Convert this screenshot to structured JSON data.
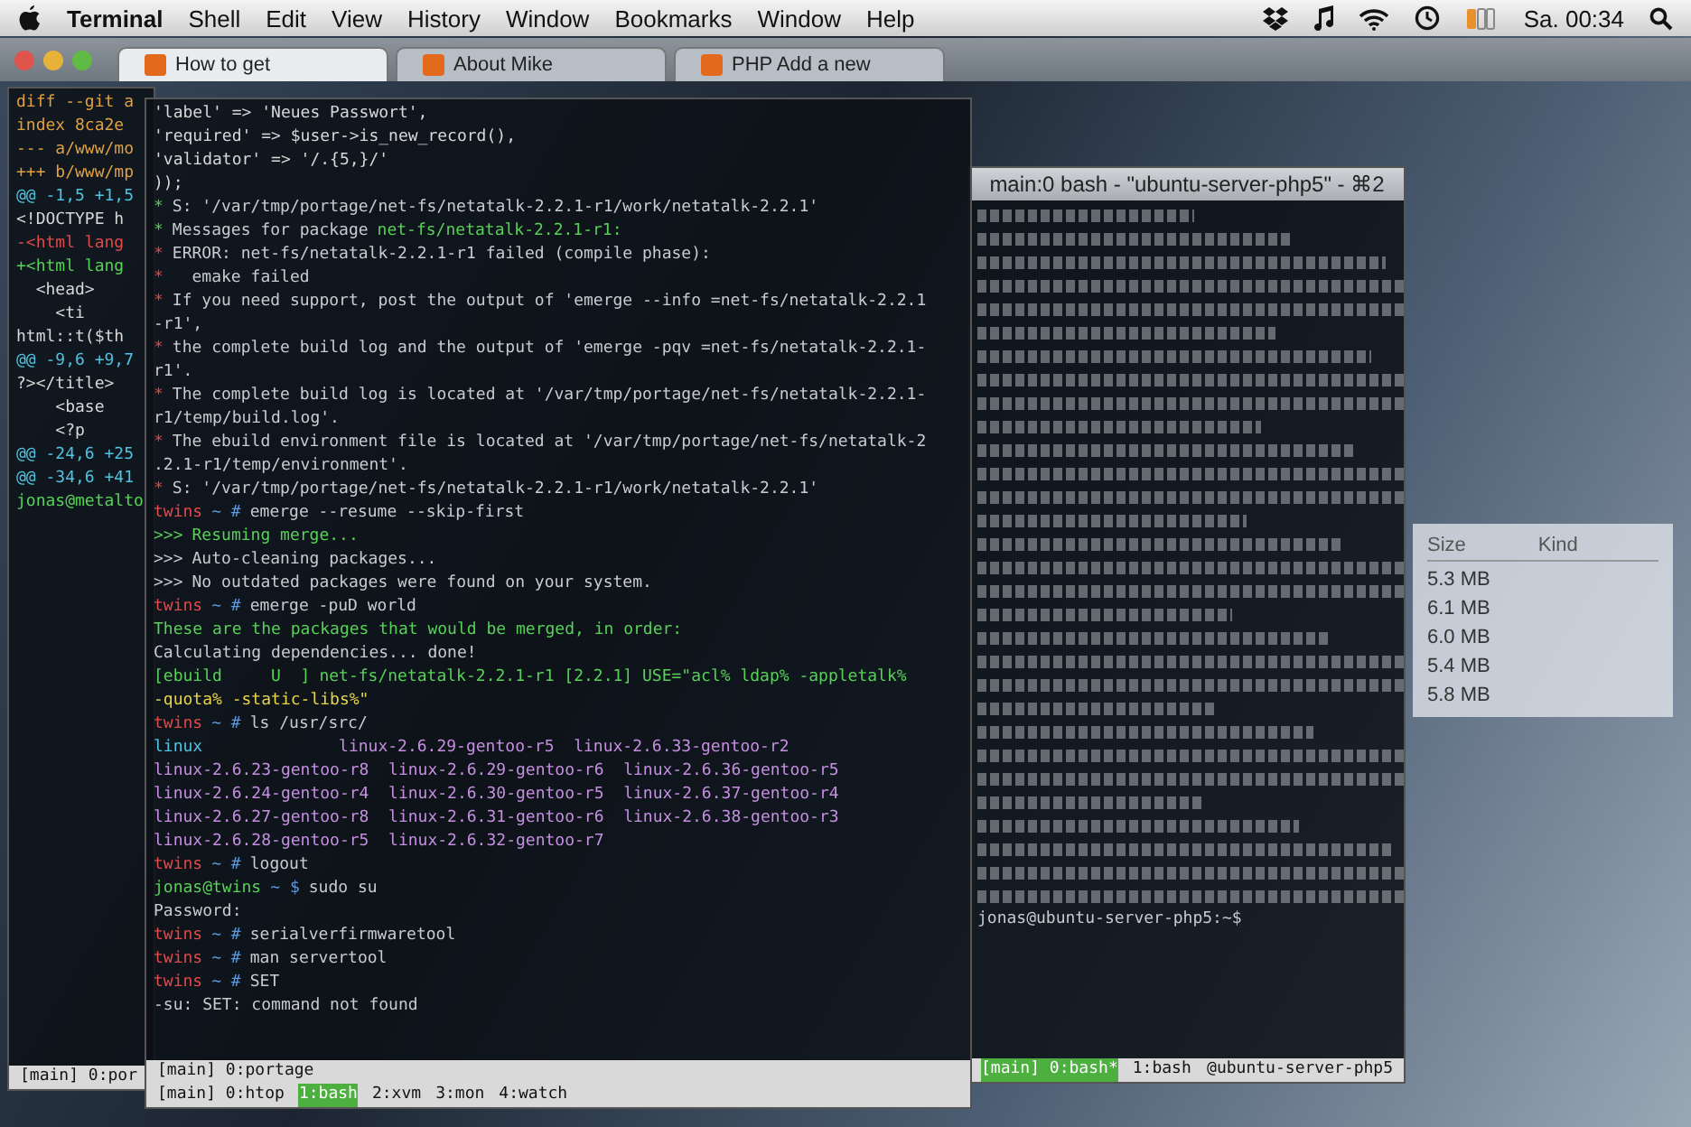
{
  "menubar": {
    "app": "Terminal",
    "menus": [
      "Shell",
      "Edit",
      "View",
      "History",
      "Window",
      "Bookmarks",
      "Window",
      "Help"
    ],
    "clock": "Sa. 00:34"
  },
  "browser": {
    "tabs": [
      {
        "label": "How to get",
        "selected": true
      },
      {
        "label": "About Mike",
        "selected": false
      },
      {
        "label": "PHP Add a new",
        "selected": false
      }
    ]
  },
  "left_terminal": {
    "lines": [
      {
        "text": "diff --git a",
        "kind": "header"
      },
      {
        "text": "index 8ca2e",
        "kind": "header"
      },
      {
        "text": "--- a/www/mo",
        "kind": "header"
      },
      {
        "text": "+++ b/www/mp",
        "kind": "header"
      },
      {
        "text": "@@ -1,5 +1,5",
        "kind": "hunk"
      },
      {
        "text": "<!DOCTYPE h",
        "kind": "code"
      },
      {
        "text": "-<html lang",
        "kind": "removed"
      },
      {
        "text": "+<html lang",
        "kind": "added"
      },
      {
        "text": "  <head>",
        "kind": "code"
      },
      {
        "text": "    <ti",
        "kind": "code"
      },
      {
        "text": "html::t($th",
        "kind": "code"
      },
      {
        "text": "@@ -9,6 +9,7",
        "kind": "hunk"
      },
      {
        "text": "?></title>",
        "kind": "code"
      },
      {
        "text": "    <base",
        "kind": "code"
      },
      {
        "text": "    <?p",
        "kind": "code"
      },
      {
        "text": "@@ -24,6 +25",
        "kind": "hunk"
      },
      {
        "text": "@@ -34,6 +41",
        "kind": "hunk"
      },
      {
        "text": "jonas@metalto",
        "kind": "prompt"
      }
    ],
    "status": "[main] 0:por"
  },
  "middle_terminal": {
    "lines": [
      {
        "parts": [
          {
            "text": "'label' => 'Neues Passwort',",
            "kind": "code"
          }
        ]
      },
      {
        "parts": [
          {
            "text": "'required' => $user->is_new_record(),",
            "kind": "code"
          }
        ]
      },
      {
        "parts": [
          {
            "text": "'validator' => '/.{5,}/'",
            "kind": "code"
          }
        ]
      },
      {
        "parts": [
          {
            "text": "));",
            "kind": "code"
          }
        ]
      },
      {
        "parts": [
          {
            "text": "*",
            "kind": "star"
          },
          {
            "text": "S: '/var/tmp/portage/net-fs/netatalk-2.2.1-r1/work/netatalk-2.2.1'",
            "kind": "plain"
          }
        ]
      },
      {
        "parts": [
          {
            "text": "*",
            "kind": "star"
          },
          {
            "text": "Messages for package",
            "kind": "plain"
          },
          {
            "text": "net-fs/netatalk-2.2.1-r1:",
            "kind": "ok"
          }
        ]
      },
      {
        "parts": [
          {
            "text": "*",
            "kind": "error"
          },
          {
            "text": "ERROR: net-fs/netatalk-2.2.1-r1 failed (compile phase):",
            "kind": "plain"
          }
        ]
      },
      {
        "parts": [
          {
            "text": "*",
            "kind": "error"
          },
          {
            "text": "  emake failed",
            "kind": "plain"
          }
        ]
      },
      {
        "parts": [
          {
            "text": "*",
            "kind": "error"
          },
          {
            "text": "If you need support, post the output of 'emerge --info =net-fs/netatalk-2.2.1",
            "kind": "plain"
          }
        ]
      },
      {
        "parts": [
          {
            "text": "-r1',",
            "kind": "plain"
          }
        ]
      },
      {
        "parts": [
          {
            "text": "*",
            "kind": "error"
          },
          {
            "text": "the complete build log and the output of 'emerge -pqv =net-fs/netatalk-2.2.1-",
            "kind": "plain"
          }
        ]
      },
      {
        "parts": [
          {
            "text": "r1'.",
            "kind": "plain"
          }
        ]
      },
      {
        "parts": [
          {
            "text": "*",
            "kind": "error"
          },
          {
            "text": "The complete build log is located at '/var/tmp/portage/net-fs/netatalk-2.2.1-",
            "kind": "plain"
          }
        ]
      },
      {
        "parts": [
          {
            "text": "r1/temp/build.log'.",
            "kind": "plain"
          }
        ]
      },
      {
        "parts": [
          {
            "text": "*",
            "kind": "error"
          },
          {
            "text": "The ebuild environment file is located at '/var/tmp/portage/net-fs/netatalk-2",
            "kind": "plain"
          }
        ]
      },
      {
        "parts": [
          {
            "text": ".2.1-r1/temp/environment'.",
            "kind": "plain"
          }
        ]
      },
      {
        "parts": [
          {
            "text": "*",
            "kind": "error"
          },
          {
            "text": "S: '/var/tmp/portage/net-fs/netatalk-2.2.1-r1/work/netatalk-2.2.1'",
            "kind": "plain"
          }
        ]
      },
      {
        "parts": [
          {
            "text": "twins",
            "kind": "host"
          },
          {
            "text": "~ #",
            "kind": "path"
          },
          {
            "text": "emerge --resume --skip-first",
            "kind": "plain"
          }
        ]
      },
      {
        "parts": [
          {
            "text": ">>>",
            "kind": "ok"
          },
          {
            "text": "Resuming merge...",
            "kind": "ok"
          }
        ]
      },
      {
        "parts": [
          {
            "text": ">>>",
            "kind": "plain"
          },
          {
            "text": "Auto-cleaning packages...",
            "kind": "plain"
          }
        ]
      },
      {
        "parts": [
          {
            "text": ">>>",
            "kind": "plain"
          },
          {
            "text": "No outdated packages were found on your system.",
            "kind": "plain"
          }
        ]
      },
      {
        "parts": [
          {
            "text": "twins",
            "kind": "host"
          },
          {
            "text": "~ #",
            "kind": "path"
          },
          {
            "text": "emerge -puD world",
            "kind": "plain"
          }
        ]
      },
      {
        "parts": [
          {
            "text": "These are the packages that would be merged, in order:",
            "kind": "ok"
          }
        ]
      },
      {
        "parts": [
          {
            "text": "Calculating dependencies... done!",
            "kind": "plain"
          }
        ]
      },
      {
        "parts": [
          {
            "text": "[ebuild     U  ]",
            "kind": "ok"
          },
          {
            "text": "net-fs/netatalk-2.2.1-r1 [2.2.1] USE=\"acl% ldap% -appletalk%",
            "kind": "ok"
          }
        ]
      },
      {
        "parts": [
          {
            "text": "-quota% -static-libs%\"",
            "kind": "warn"
          }
        ]
      },
      {
        "parts": [
          {
            "text": "twins",
            "kind": "host"
          },
          {
            "text": "~ #",
            "kind": "path"
          },
          {
            "text": "ls /usr/src/",
            "kind": "plain"
          }
        ]
      },
      {
        "parts": [
          {
            "text": "linux",
            "kind": "dir"
          },
          {
            "text": "             linux-2.6.29-gentoo-r5  linux-2.6.33-gentoo-r2",
            "kind": "link"
          }
        ]
      },
      {
        "parts": [
          {
            "text": "linux-2.6.23-gentoo-r8  linux-2.6.29-gentoo-r6  linux-2.6.36-gentoo-r5",
            "kind": "link"
          }
        ]
      },
      {
        "parts": [
          {
            "text": "linux-2.6.24-gentoo-r4  linux-2.6.30-gentoo-r5  linux-2.6.37-gentoo-r4",
            "kind": "link"
          }
        ]
      },
      {
        "parts": [
          {
            "text": "linux-2.6.27-gentoo-r8  linux-2.6.31-gentoo-r6  linux-2.6.38-gentoo-r3",
            "kind": "link"
          }
        ]
      },
      {
        "parts": [
          {
            "text": "linux-2.6.28-gentoo-r5  linux-2.6.32-gentoo-r7",
            "kind": "link"
          }
        ]
      },
      {
        "parts": [
          {
            "text": "twins",
            "kind": "host"
          },
          {
            "text": "~ #",
            "kind": "path"
          },
          {
            "text": "logout",
            "kind": "plain"
          }
        ]
      },
      {
        "parts": [
          {
            "text": "jonas@twins",
            "kind": "ok"
          },
          {
            "text": "~ $",
            "kind": "path"
          },
          {
            "text": "sudo su",
            "kind": "plain"
          }
        ]
      },
      {
        "parts": [
          {
            "text": "Password:",
            "kind": "plain"
          }
        ]
      },
      {
        "parts": [
          {
            "text": "twins",
            "kind": "host"
          },
          {
            "text": "~ #",
            "kind": "path"
          },
          {
            "text": "serialverfirmwaretool",
            "kind": "plain"
          }
        ]
      },
      {
        "parts": [
          {
            "text": "twins",
            "kind": "host"
          },
          {
            "text": "~ #",
            "kind": "path"
          },
          {
            "text": "man servertool",
            "kind": "plain"
          }
        ]
      },
      {
        "parts": [
          {
            "text": "twins",
            "kind": "host"
          },
          {
            "text": "~ #",
            "kind": "path"
          },
          {
            "text": "SET",
            "kind": "plain"
          }
        ]
      },
      {
        "parts": [
          {
            "text": "-su: SET: command not found",
            "kind": "plain"
          }
        ]
      }
    ],
    "status": "[main] 0:portage",
    "windows": [
      {
        "label": "[main] 0:htop",
        "selected": false
      },
      {
        "label": "1:bash",
        "selected": true
      },
      {
        "label": "2:xvm",
        "selected": false
      },
      {
        "label": "3:mon",
        "selected": false
      },
      {
        "label": "4:watch",
        "selected": false
      }
    ]
  },
  "right_terminal": {
    "title": "main:0 bash - \"ubuntu-server-php5\" - ⌘2",
    "prompt": "jonas@ubuntu-server-php5:~$",
    "windows": [
      {
        "label": "[main] 0:bash*",
        "selected": true
      },
      {
        "label": "1:bash",
        "selected": false
      }
    ],
    "host": "@ubuntu-server-php5"
  },
  "file_list": {
    "columns": [
      "Size",
      "Kind"
    ],
    "sizes": [
      "5.3 MB",
      "6.1 MB",
      "6.0 MB",
      "5.4 MB",
      "5.8 MB"
    ]
  }
}
